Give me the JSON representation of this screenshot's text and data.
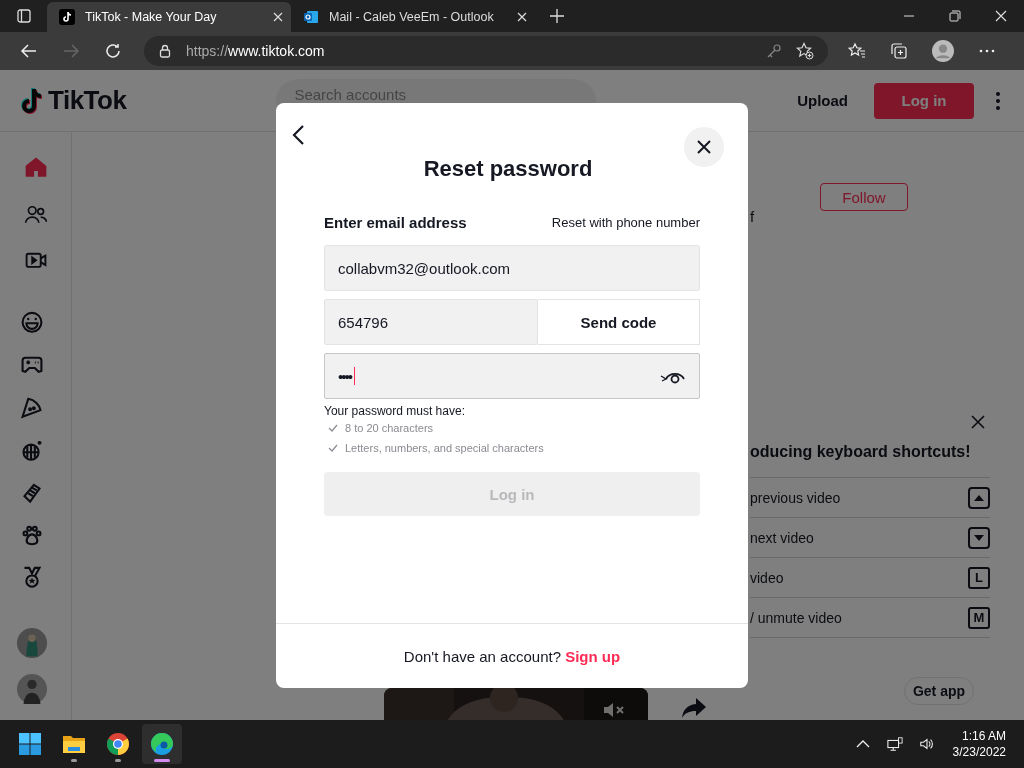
{
  "browser": {
    "tabs": [
      {
        "title": "TikTok - Make Your Day",
        "kind": "tiktok",
        "selected": true
      },
      {
        "title": "Mail - Caleb VeeEm - Outlook",
        "kind": "outlook",
        "selected": false
      }
    ],
    "url": {
      "scheme": "https://",
      "host": "www.tiktok.com"
    }
  },
  "header": {
    "logo": "TikTok",
    "search_placeholder": "Search accounts",
    "upload": "Upload",
    "login": "Log in"
  },
  "sidebar": {
    "nav": [
      {
        "kind": "home",
        "selected": true
      },
      {
        "kind": "people",
        "selected": false
      },
      {
        "kind": "live",
        "selected": false
      }
    ],
    "topics": [
      {
        "kind": "smile"
      },
      {
        "kind": "gamepad"
      },
      {
        "kind": "pizza"
      },
      {
        "kind": "disco"
      },
      {
        "kind": "comb"
      },
      {
        "kind": "paw"
      },
      {
        "kind": "medal"
      }
    ]
  },
  "feed": {
    "follow": "Follow",
    "caption": "f"
  },
  "shortcuts": {
    "title": "oducing keyboard shortcuts!",
    "items": [
      {
        "label": "previous video",
        "kind": "up"
      },
      {
        "label": "next video",
        "kind": "down"
      },
      {
        "label": "video",
        "kind": "letter",
        "key": "L"
      },
      {
        "label": "/ unmute video",
        "kind": "letter",
        "key": "M"
      }
    ]
  },
  "get_app": "Get app",
  "modal": {
    "title": "Reset password",
    "method": "Enter email address",
    "alt_method": "Reset with phone number",
    "email": "collabvm32@outlook.com",
    "code": "654796",
    "send_code": "Send code",
    "password": "••••",
    "rules_title": "Your password must have:",
    "rules": [
      {
        "text": "8 to 20 characters",
        "met": false
      },
      {
        "text": "Letters, numbers, and special characters",
        "met": false
      }
    ],
    "submit": {
      "label": "Log in",
      "disabled": true
    },
    "footer": {
      "text": "Don't have an account?",
      "link": "Sign up"
    }
  },
  "taskbar": {
    "apps": [
      {
        "kind": "start",
        "selected": false
      },
      {
        "kind": "explorer",
        "selected": false
      },
      {
        "kind": "chrome",
        "selected": false
      },
      {
        "kind": "edge",
        "selected": true
      }
    ],
    "time": "1:16 AM",
    "date": "3/23/2022"
  }
}
